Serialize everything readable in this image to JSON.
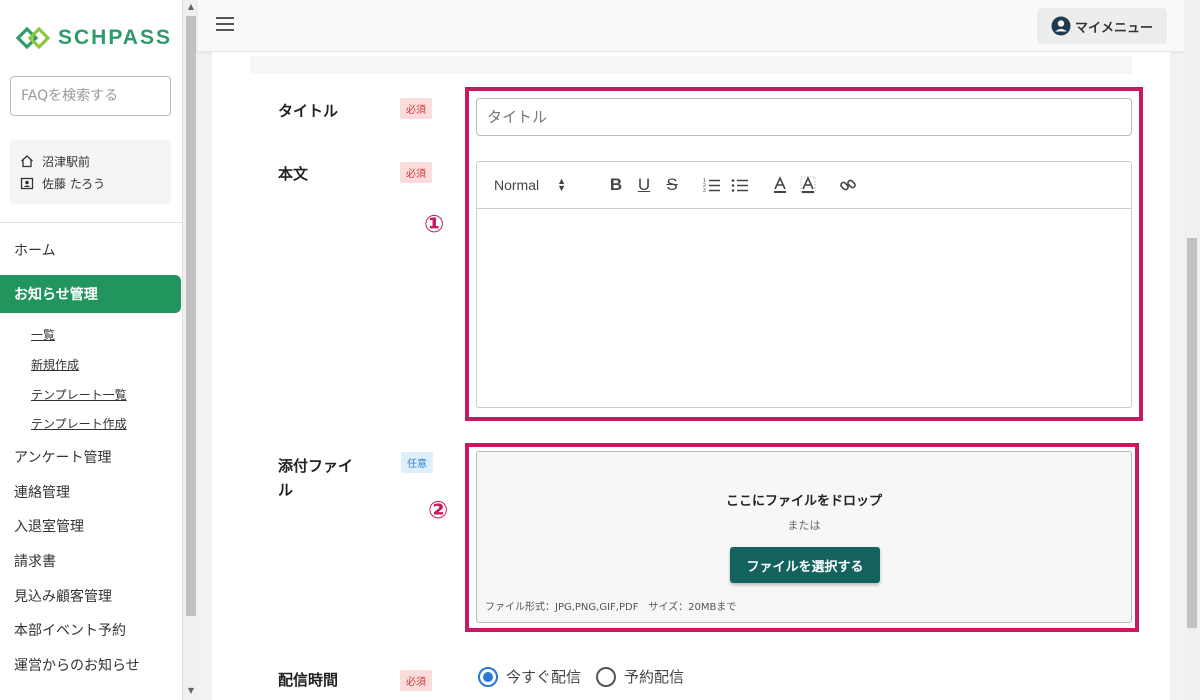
{
  "colors": {
    "brand": "#2f9a6a",
    "nav_active": "#22955f",
    "callout": "#c7195f",
    "primary_button": "#13625e",
    "radio_selected": "#2a78d6",
    "required_badge": "#d13737",
    "optional_badge": "#2f83c7"
  },
  "logo": {
    "text": "SCHPASS"
  },
  "sidebar": {
    "search_placeholder": "FAQを検索する",
    "school": "沼津駅前",
    "user": "佐藤 たろう",
    "nav": [
      {
        "label": "ホーム"
      },
      {
        "label": "お知らせ管理",
        "active": true
      },
      {
        "label": "アンケート管理"
      },
      {
        "label": "連絡管理"
      },
      {
        "label": "入退室管理"
      },
      {
        "label": "請求書"
      },
      {
        "label": "見込み顧客管理"
      },
      {
        "label": "本部イベント予約"
      },
      {
        "label": "運営からのお知らせ"
      }
    ],
    "sub_items": [
      {
        "label": "一覧"
      },
      {
        "label": "新規作成"
      },
      {
        "label": "テンプレート一覧"
      },
      {
        "label": "テンプレート作成"
      }
    ]
  },
  "header": {
    "my_menu_label": "マイメニュー"
  },
  "form": {
    "title_label": "タイトル",
    "title_placeholder": "タイトル",
    "body_label": "本文",
    "required": "必須",
    "optional": "任意",
    "editor": {
      "format_value": "Normal"
    },
    "attach_label_line1": "添付ファイ",
    "attach_label_line2": "ル",
    "dropzone": {
      "title": "ここにファイルをドロップ",
      "or": "または",
      "button": "ファイルを選択する",
      "note": "ファイル形式：JPG,PNG,GIF,PDF　サイズ：20MBまで"
    },
    "delivery_label": "配信時間",
    "delivery_options": [
      {
        "label": "今すぐ配信",
        "selected": true
      },
      {
        "label": "予約配信",
        "selected": false
      }
    ]
  },
  "callouts": {
    "one": "①",
    "two": "②"
  }
}
